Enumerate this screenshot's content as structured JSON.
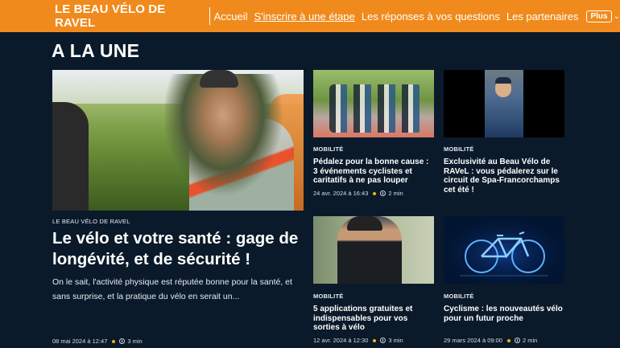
{
  "header": {
    "brand": "LE BEAU VÉLO DE RAVEL",
    "nav": [
      {
        "label": "Accueil"
      },
      {
        "label": "S'inscrire à une étape"
      },
      {
        "label": "Les réponses à vos questions"
      },
      {
        "label": "Les partenaires"
      }
    ],
    "more_label": "Plus"
  },
  "section_title": "A LA UNE",
  "main_article": {
    "category": "LE BEAU VÉLO DE RAVEL",
    "title": "Le vélo et votre santé : gage de longévité, et de sécurité !",
    "excerpt": "On le sait, l'activité physique est réputée bonne pour la santé, et sans surprise, et la pratique du vélo en serait un...",
    "date": "08 mai 2024 à 12:47",
    "read_time": "3 min"
  },
  "cards": [
    {
      "category": "MOBILITÉ",
      "title": "Pédalez pour la bonne cause : 3 événements cyclistes et caritatifs à ne pas louper",
      "date": "24 avr. 2024 à 16:43",
      "read_time": "2 min"
    },
    {
      "category": "MOBILITÉ",
      "title": "Exclusivité au Beau Vélo de RAVeL : vous pédalerez sur le circuit de Spa-Francorchamps cet été !",
      "date": "",
      "read_time": ""
    },
    {
      "category": "MOBILITÉ",
      "title": "5 applications gratuites et indispensables pour vos sorties à vélo",
      "date": "12 avr. 2024 à 12:30",
      "read_time": "3 min"
    },
    {
      "category": "MOBILITÉ",
      "title": "Cyclisme : les nouveautés vélo pour un futur proche",
      "date": "29 mars 2024 à 09:00",
      "read_time": "2 min"
    }
  ],
  "colors": {
    "header_bg": "#f08a1c",
    "page_bg": "#0b1a2a",
    "accent_dot": "#f0b31c"
  }
}
